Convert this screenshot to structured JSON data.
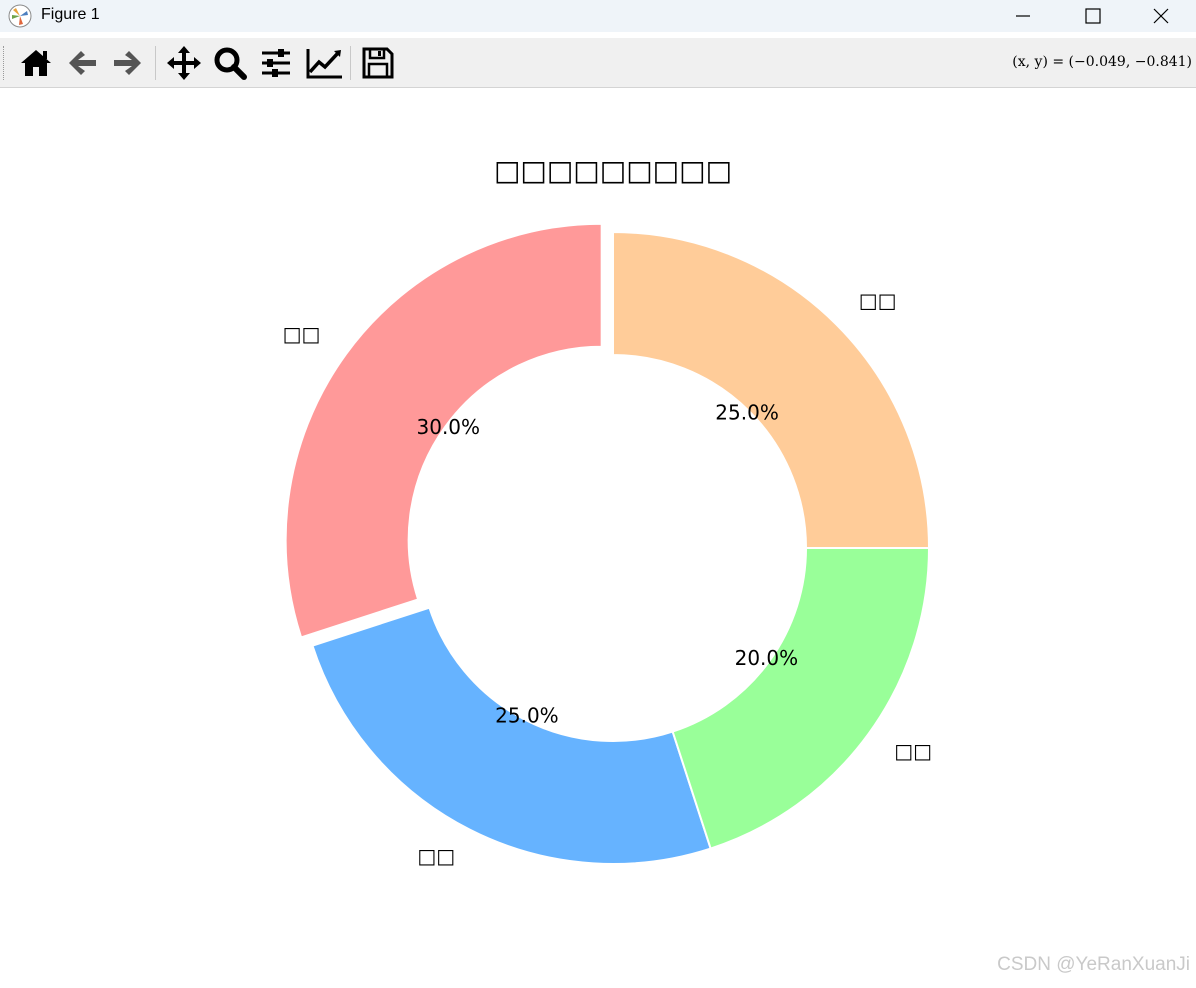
{
  "window": {
    "title": "Figure 1",
    "controls": [
      "minimize",
      "maximize",
      "close"
    ]
  },
  "toolbar": {
    "tools": [
      {
        "name": "home-icon"
      },
      {
        "name": "back-arrow-icon"
      },
      {
        "name": "forward-arrow-icon"
      },
      {
        "name": "pan-icon"
      },
      {
        "name": "zoom-icon"
      },
      {
        "name": "configure-subplots-icon"
      },
      {
        "name": "edit-axis-icon"
      },
      {
        "name": "save-icon"
      }
    ],
    "coordinates": "(x, y) = (−0.049, −0.841)"
  },
  "chart_data": {
    "type": "pie",
    "donut": true,
    "title": "□□□□□□□□□",
    "start_angle_deg": 90,
    "direction": "counterclockwise",
    "slices": [
      {
        "label": "□□",
        "value": 30,
        "pct_label": "30.0%",
        "color": "#ff9999",
        "explode": true
      },
      {
        "label": "□□",
        "value": 25,
        "pct_label": "25.0%",
        "color": "#66b3ff",
        "explode": false
      },
      {
        "label": "□□",
        "value": 20,
        "pct_label": "20.0%",
        "color": "#99ff99",
        "explode": false
      },
      {
        "label": "□□",
        "value": 25,
        "pct_label": "25.0%",
        "color": "#ffcc99",
        "explode": false
      }
    ]
  },
  "watermark": "CSDN @YeRanXuanJi"
}
